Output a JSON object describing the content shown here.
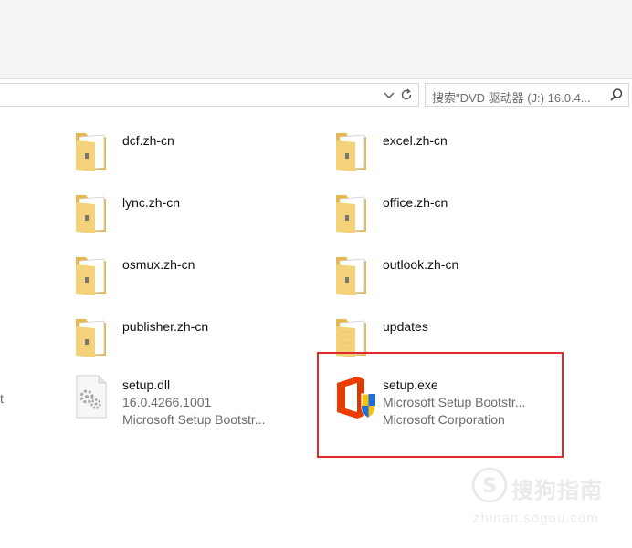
{
  "address_bar": {
    "dropdown_icon": "chevron-down-icon",
    "refresh_icon": "refresh-icon"
  },
  "search": {
    "placeholder": "搜索\"DVD 驱动器 (J:) 16.0.4...",
    "icon": "search-icon"
  },
  "left_cutoff_text": "t",
  "files": {
    "left_column": [
      {
        "name": "dcf.zh-cn",
        "type": "folder"
      },
      {
        "name": "lync.zh-cn",
        "type": "folder"
      },
      {
        "name": "osmux.zh-cn",
        "type": "folder"
      },
      {
        "name": "publisher.zh-cn",
        "type": "folder"
      },
      {
        "name": "setup.dll",
        "type": "dll",
        "line1": "16.0.4266.1001",
        "line2": "Microsoft Setup Bootstr..."
      }
    ],
    "right_column": [
      {
        "name": "excel.zh-cn",
        "type": "folder"
      },
      {
        "name": "office.zh-cn",
        "type": "folder"
      },
      {
        "name": "outlook.zh-cn",
        "type": "folder"
      },
      {
        "name": "updates",
        "type": "folder-empty"
      },
      {
        "name": "setup.exe",
        "type": "exe",
        "line1": "Microsoft Setup Bootstr...",
        "line2": "Microsoft Corporation"
      }
    ]
  },
  "highlight_color": "#e0292b",
  "watermark": {
    "chinese": "搜狗指南",
    "domain": "zhinan.sogou.com"
  }
}
